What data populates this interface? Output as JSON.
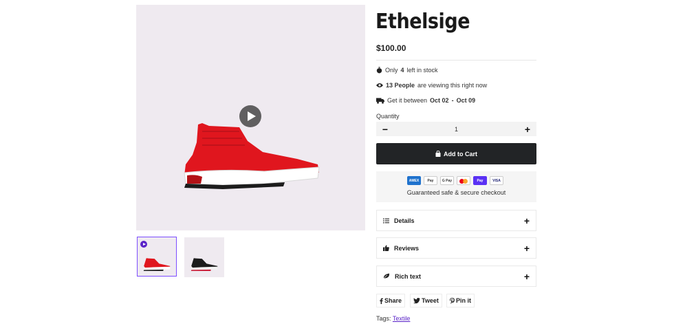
{
  "product": {
    "title": "Ethelsige",
    "price": "$100.00"
  },
  "stock": {
    "prefix": "Only",
    "count": "4",
    "suffix": "left in stock"
  },
  "viewers": {
    "count": "13 People",
    "suffix": "are viewing this right now"
  },
  "delivery": {
    "prefix": "Get it between",
    "start": "Oct 02",
    "sep": "-",
    "end": "Oct 09"
  },
  "quantity": {
    "label": "Quantity",
    "value": "1",
    "minus": "−",
    "plus": "+"
  },
  "cart": {
    "label": "Add to Cart"
  },
  "payments": {
    "icons": [
      "AMEX",
      "Pay",
      "G Pay",
      "",
      "Pay",
      "VISA"
    ],
    "text": "Guaranteed safe & secure checkout"
  },
  "accordion": [
    {
      "label": "Details",
      "icon": "list-icon"
    },
    {
      "label": "Reviews",
      "icon": "thumbs-up-icon"
    },
    {
      "label": "Rich text",
      "icon": "leaf-icon"
    }
  ],
  "share": {
    "facebook": "Share",
    "twitter": "Tweet",
    "pinterest": "Pin it"
  },
  "tags": {
    "label": "Tags:",
    "value": "Textile"
  },
  "colors": {
    "accent": "#5a23c8",
    "button": "#222426",
    "image_bg": "#efeaf0",
    "shoe_red": "#e0161e"
  }
}
